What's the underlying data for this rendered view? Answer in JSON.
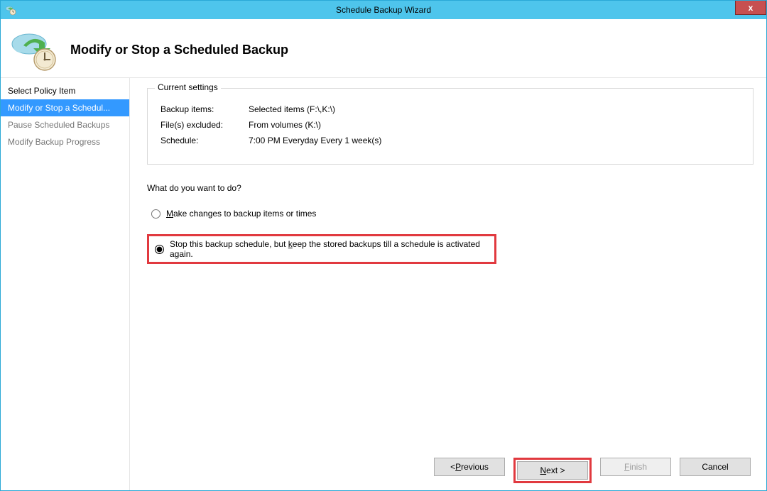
{
  "window": {
    "title": "Schedule Backup Wizard",
    "close_label": "x"
  },
  "header": {
    "title": "Modify or Stop a Scheduled Backup"
  },
  "sidebar": {
    "items": [
      {
        "label": "Select Policy Item",
        "enabled": true
      },
      {
        "label": "Modify or Stop a Schedul...",
        "selected": true
      },
      {
        "label": "Pause Scheduled Backups"
      },
      {
        "label": "Modify Backup Progress"
      }
    ]
  },
  "content": {
    "settings_legend": "Current settings",
    "backup_items_label": "Backup items:",
    "backup_items_value": "Selected items (F:\\,K:\\)",
    "files_excluded_label": "File(s) excluded:",
    "files_excluded_value": "From volumes (K:\\)",
    "schedule_label": "Schedule:",
    "schedule_value": "7:00 PM Everyday Every 1 week(s)",
    "prompt": "What do you want to do?",
    "radio1_pre": "",
    "radio1_ul": "M",
    "radio1_post": "ake changes to backup items or times",
    "radio2_pre": "Stop this backup schedule, but ",
    "radio2_ul": "k",
    "radio2_post": "eep the stored backups till a schedule is activated again."
  },
  "footer": {
    "prev_pre": "< ",
    "prev_ul": "P",
    "prev_post": "revious",
    "next_ul": "N",
    "next_post": "ext >",
    "finish_ul": "F",
    "finish_post": "inish",
    "cancel": "Cancel"
  }
}
